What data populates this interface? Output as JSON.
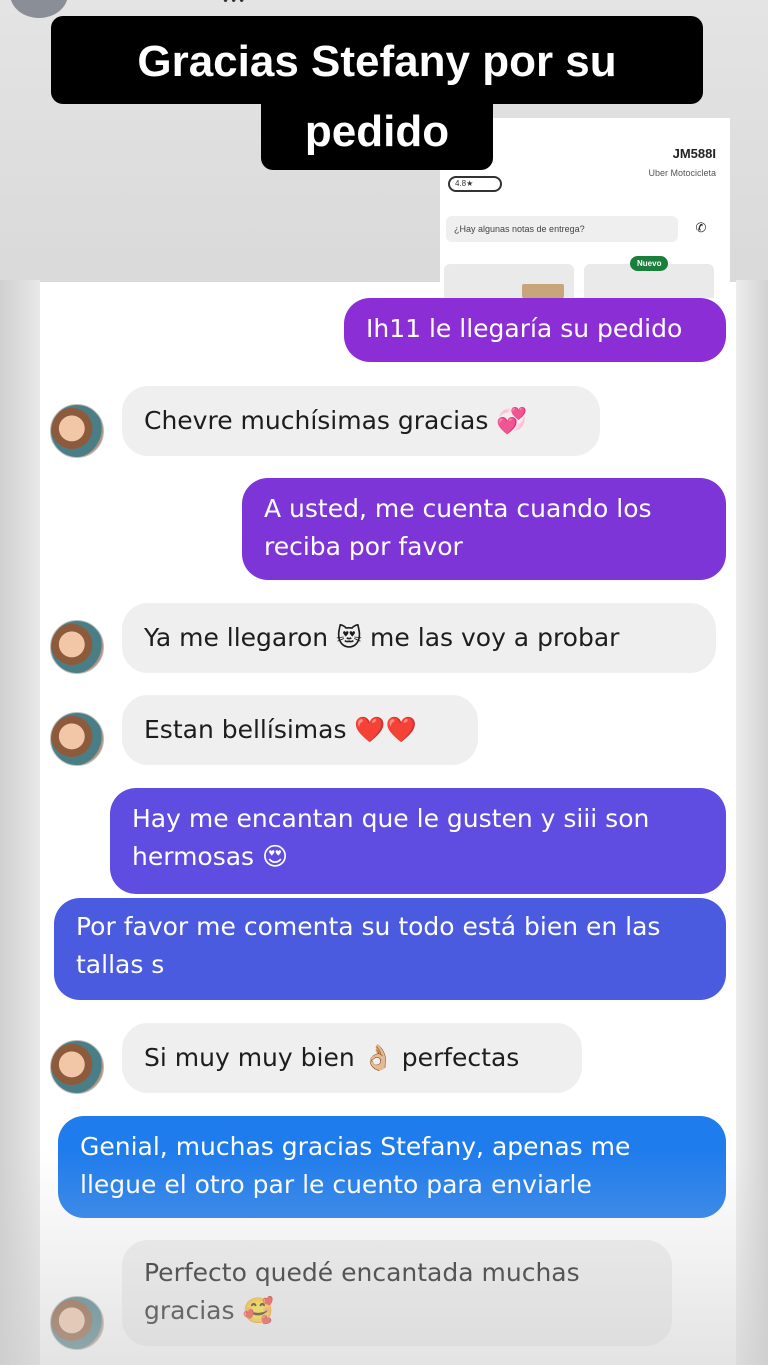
{
  "title": {
    "line1": "Gracias Stefany por su",
    "line2": "pedido"
  },
  "uber_card": {
    "plate": "JM588I",
    "vehicle": "Uber Motocicleta",
    "rating": "4.8★",
    "notes_placeholder": "¿Hay algunas notas de entrega?",
    "badge": "Nuevo"
  },
  "messages": [
    {
      "side": "out",
      "text": "Ih11 le llegaría su pedido",
      "color": "#8b2ed6"
    },
    {
      "side": "in",
      "text": "Chevre muchísimas gracias 💞"
    },
    {
      "side": "out",
      "text": "A usted, me cuenta cuando los reciba por favor",
      "color": "#7d35d8"
    },
    {
      "side": "in",
      "text": "Ya me llegaron 😻 me las voy a probar"
    },
    {
      "side": "in",
      "text": "Estan bellísimas ❤️❤️"
    },
    {
      "side": "out",
      "text": "Hay me encantan que le gusten y siii son hermosas 😍",
      "color": "#5f4ce0"
    },
    {
      "side": "out",
      "text": "Por favor me comenta su todo está bien en las tallas s",
      "color": "#4a5be0"
    },
    {
      "side": "in",
      "text": "Si muy muy bien 👌🏼 perfectas"
    },
    {
      "side": "out",
      "text": "Genial, muchas gracias Stefany, apenas me llegue el otro par le cuento para enviarle",
      "color": "#1f7cec"
    },
    {
      "side": "in",
      "text": "Perfecto quedé encantada muchas gracias 🥰"
    }
  ]
}
